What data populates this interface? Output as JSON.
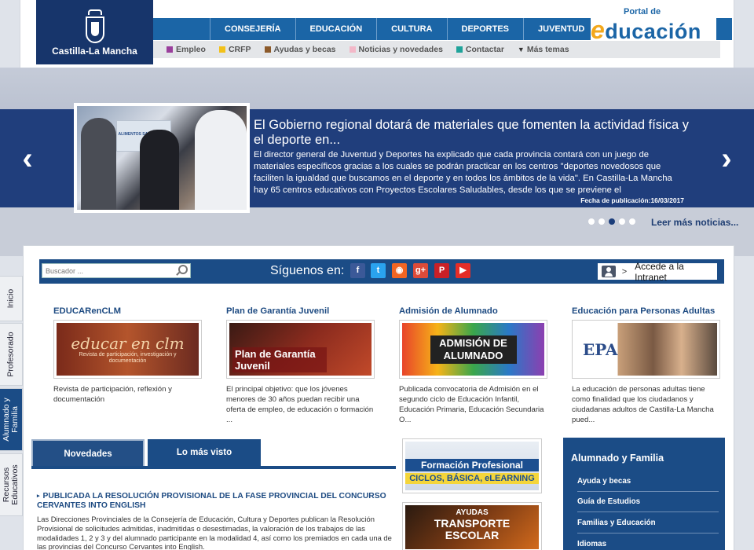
{
  "header": {
    "logo_name": "Castilla-La Mancha",
    "main_nav": [
      "CONSEJERÍA",
      "EDUCACIÓN",
      "CULTURA",
      "DEPORTES",
      "JUVENTUD"
    ],
    "brand_small": "Portal de",
    "brand_e": "e",
    "brand_rest": "ducación",
    "sub_nav": [
      {
        "label": "Empleo",
        "color": "#9a3f9c"
      },
      {
        "label": "CRFP",
        "color": "#f2c11a"
      },
      {
        "label": "Ayudas y becas",
        "color": "#8c5a2b"
      },
      {
        "label": "Noticias y novedades",
        "color": "#f3b8c8"
      },
      {
        "label": "Contactar",
        "color": "#1fa39a"
      },
      {
        "label": "Más temas",
        "icon": "chevron-down-icon"
      }
    ]
  },
  "slider": {
    "title": "El Gobierno regional dotará de materiales que fomenten la actividad física y el deporte en...",
    "text": "El director general de Juventud y Deportes ha explicado que cada provincia contará con un juego de materiales específicos gracias a los cuales se podrán practicar en los centros \"deportes novedosos que faciliten la igualdad que buscamos en el deporte y en todos los ámbitos de la vida\".   En Castilla-La Mancha hay 65 centros educativos con Proyectos Escolares Saludables, desde los que se previene el",
    "date": "Fecha de publicación:16/03/2017",
    "photo_sign": "ALIMENTOS SALUDABLES",
    "prev_icon": "‹",
    "next_icon": "›",
    "dots": 5,
    "active_dot": 2,
    "more_link": "Leer más noticias..."
  },
  "side_tabs": [
    {
      "label": "Inicio"
    },
    {
      "label": "Profesorado"
    },
    {
      "label": "Alumnado y Familia"
    },
    {
      "label": "Recursos Educativos"
    }
  ],
  "toolbar": {
    "search_placeholder": "Buscador ...",
    "follow_label": "Síguenos en:",
    "social": [
      {
        "glyph": "f",
        "color": "#3b5998",
        "name": "facebook-icon"
      },
      {
        "glyph": "t",
        "color": "#2aa3ef",
        "name": "twitter-icon"
      },
      {
        "glyph": "◉",
        "color": "#f26522",
        "name": "rss-icon"
      },
      {
        "glyph": "g+",
        "color": "#dd4b39",
        "name": "google-plus-icon"
      },
      {
        "glyph": "P",
        "color": "#cb2027",
        "name": "pinterest-icon"
      },
      {
        "glyph": "▶",
        "color": "#e52d27",
        "name": "youtube-icon"
      }
    ],
    "intranet_label": "Accede a la Intranet"
  },
  "cards": [
    {
      "title": "EDUCARenCLM",
      "thumb_main": "educar en clm",
      "thumb_sub": "Revista de participación, investigación y documentación",
      "desc": "Revista de participación, reflexión y documentación"
    },
    {
      "title": "Plan de Garantía Juvenil",
      "thumb_main": "Plan de Garantía Juvenil",
      "thumb_sub": "",
      "desc": "El principal objetivo: que los jóvenes menores de 30 años puedan recibir una oferta de empleo, de educación o formación ..."
    },
    {
      "title": "Admisión de Alumnado",
      "thumb_main": "ADMISIÓN DE ALUMNADO",
      "thumb_sub": "",
      "desc": "Publicada convocatoria de Admisión en el segundo ciclo de Educación Infantil, Educación Primaria, Educación Secundaria O..."
    },
    {
      "title": "Educación para Personas Adultas",
      "thumb_main": "EPA",
      "thumb_sub": "",
      "desc": "La educación de personas adultas tiene como finalidad que los ciudadanos y ciudadanas adultos de Castilla-La Mancha pued..."
    }
  ],
  "tabs": [
    "Novedades",
    "Lo más visto"
  ],
  "news": {
    "title": "PUBLICADA LA RESOLUCIÓN PROVISIONAL DE LA FASE PROVINCIAL DEL CONCURSO CERVANTES INTO ENGLISH",
    "body": "Las Direcciones Provinciales de la Consejería de Educación, Cultura y Deportes publican la Resolución Provisional de solicitudes admitidas, inadmitidas o desestimadas, la valoración de los trabajos de las modalidades 1, 2 y 3 y del alumnado participante en la modalidad 4, así como los premiados en cada una de las provincias del Concurso Cervantes into English."
  },
  "banners": [
    {
      "line1": "Formación Profesional",
      "line2": "CICLOS, BÁSICA, eLEARNING"
    },
    {
      "line1": "AYUDAS",
      "line2": "TRANSPORTE",
      "line3": "ESCOLAR"
    }
  ],
  "panel": {
    "title": "Alumnado y Familia",
    "items": [
      "Ayuda y becas",
      "Guía de Estudios",
      "Familias y Educación",
      "Idiomas"
    ]
  }
}
